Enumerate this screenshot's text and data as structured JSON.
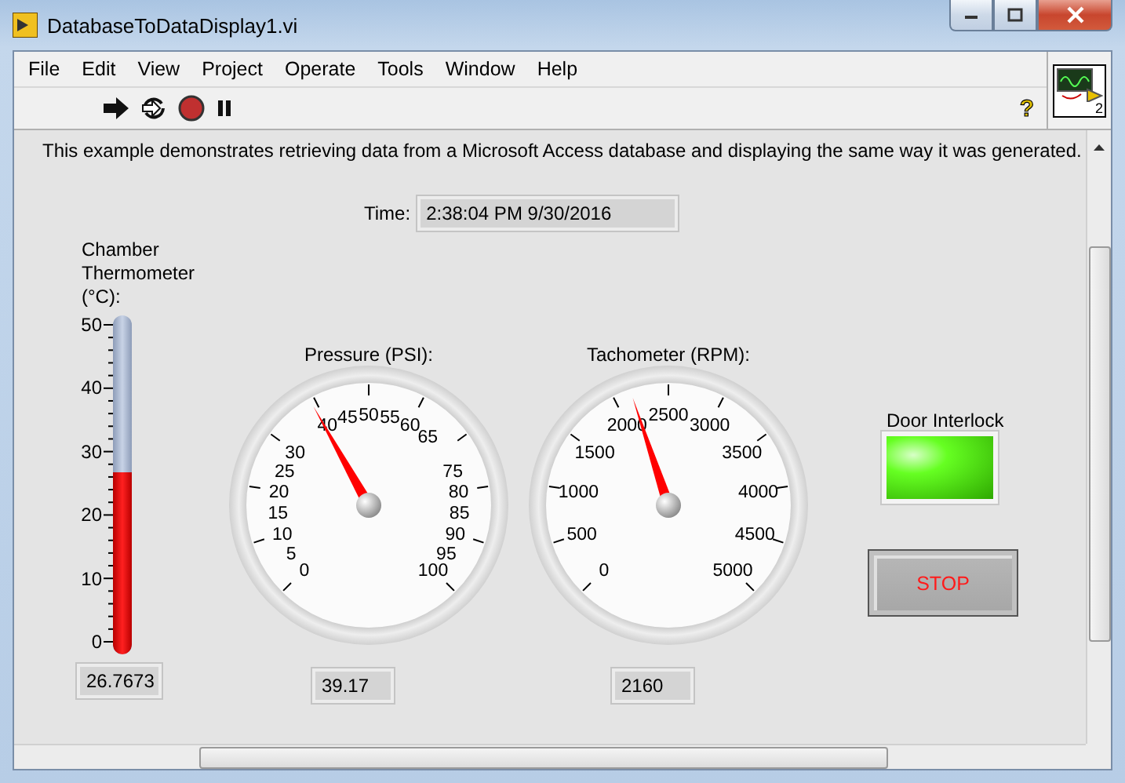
{
  "window": {
    "title": "DatabaseToDataDisplay1.vi"
  },
  "menu": [
    "File",
    "Edit",
    "View",
    "Project",
    "Operate",
    "Tools",
    "Window",
    "Help"
  ],
  "toolbar": {
    "help": "?",
    "connector_number": "2"
  },
  "description": "This example demonstrates retrieving data from a Microsoft Access database and displaying the same way it was generated.",
  "time": {
    "label": "Time:",
    "value": "2:38:04 PM  9/30/2016"
  },
  "thermometer": {
    "label": "Chamber Thermometer (°C):",
    "scale": [
      "50",
      "40",
      "30",
      "20",
      "10",
      "0"
    ],
    "level": 0.535,
    "value": "26.7673"
  },
  "gauges": [
    {
      "label": "Pressure (PSI):",
      "scale": [
        "45",
        "50",
        "55",
        "40",
        "60",
        "65",
        "30",
        "25",
        "75",
        "20",
        "80",
        "15",
        "85",
        "10",
        "90",
        "5",
        "95",
        "0",
        "100"
      ],
      "level": 0.3917,
      "value": "39.17"
    },
    {
      "label": "Tachometer (RPM):",
      "scale": [
        "2500",
        "2000",
        "3000",
        "1500",
        "3500",
        "1000",
        "4000",
        "500",
        "4500",
        "0",
        "5000"
      ],
      "level": 0.432,
      "value": "2160"
    }
  ],
  "door_interlock": {
    "label": "Door Interlock",
    "on": true
  },
  "stop_button": {
    "label": "STOP"
  }
}
